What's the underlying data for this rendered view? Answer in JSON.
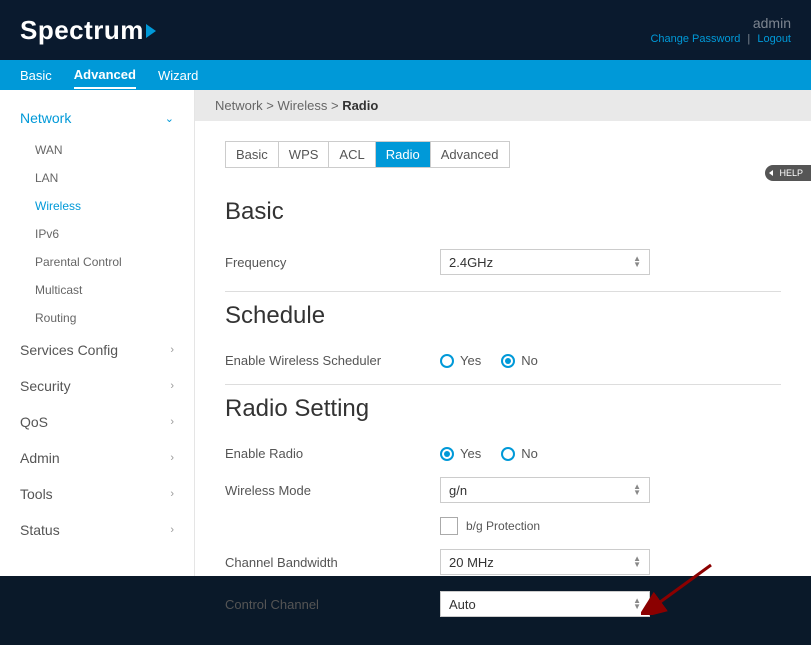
{
  "header": {
    "logo": "Spectrum",
    "user": "admin",
    "change_password": "Change Password",
    "logout": "Logout"
  },
  "top_nav": {
    "items": [
      {
        "label": "Basic",
        "active": false
      },
      {
        "label": "Advanced",
        "active": true
      },
      {
        "label": "Wizard",
        "active": false
      }
    ]
  },
  "sidebar": {
    "sections": [
      {
        "label": "Network",
        "expanded": true,
        "items": [
          {
            "label": "WAN",
            "active": false
          },
          {
            "label": "LAN",
            "active": false
          },
          {
            "label": "Wireless",
            "active": true
          },
          {
            "label": "IPv6",
            "active": false
          },
          {
            "label": "Parental Control",
            "active": false
          },
          {
            "label": "Multicast",
            "active": false
          },
          {
            "label": "Routing",
            "active": false
          }
        ]
      },
      {
        "label": "Services Config",
        "expanded": false
      },
      {
        "label": "Security",
        "expanded": false
      },
      {
        "label": "QoS",
        "expanded": false
      },
      {
        "label": "Admin",
        "expanded": false
      },
      {
        "label": "Tools",
        "expanded": false
      },
      {
        "label": "Status",
        "expanded": false
      }
    ]
  },
  "breadcrumb": {
    "parts": [
      "Network",
      "Wireless"
    ],
    "current": "Radio"
  },
  "sub_tabs": [
    {
      "label": "Basic",
      "active": false
    },
    {
      "label": "WPS",
      "active": false
    },
    {
      "label": "ACL",
      "active": false
    },
    {
      "label": "Radio",
      "active": true
    },
    {
      "label": "Advanced",
      "active": false
    }
  ],
  "help_label": "HELP",
  "sections": {
    "basic": {
      "title": "Basic",
      "frequency_label": "Frequency",
      "frequency_value": "2.4GHz"
    },
    "schedule": {
      "title": "Schedule",
      "enable_label": "Enable Wireless Scheduler",
      "yes": "Yes",
      "no": "No",
      "selected": "No"
    },
    "radio": {
      "title": "Radio Setting",
      "enable_label": "Enable Radio",
      "yes": "Yes",
      "no": "No",
      "enable_selected": "Yes",
      "mode_label": "Wireless Mode",
      "mode_value": "g/n",
      "bg_protection": "b/g Protection",
      "bandwidth_label": "Channel Bandwidth",
      "bandwidth_value": "20 MHz",
      "channel_label": "Control Channel",
      "channel_value": "Auto"
    }
  }
}
